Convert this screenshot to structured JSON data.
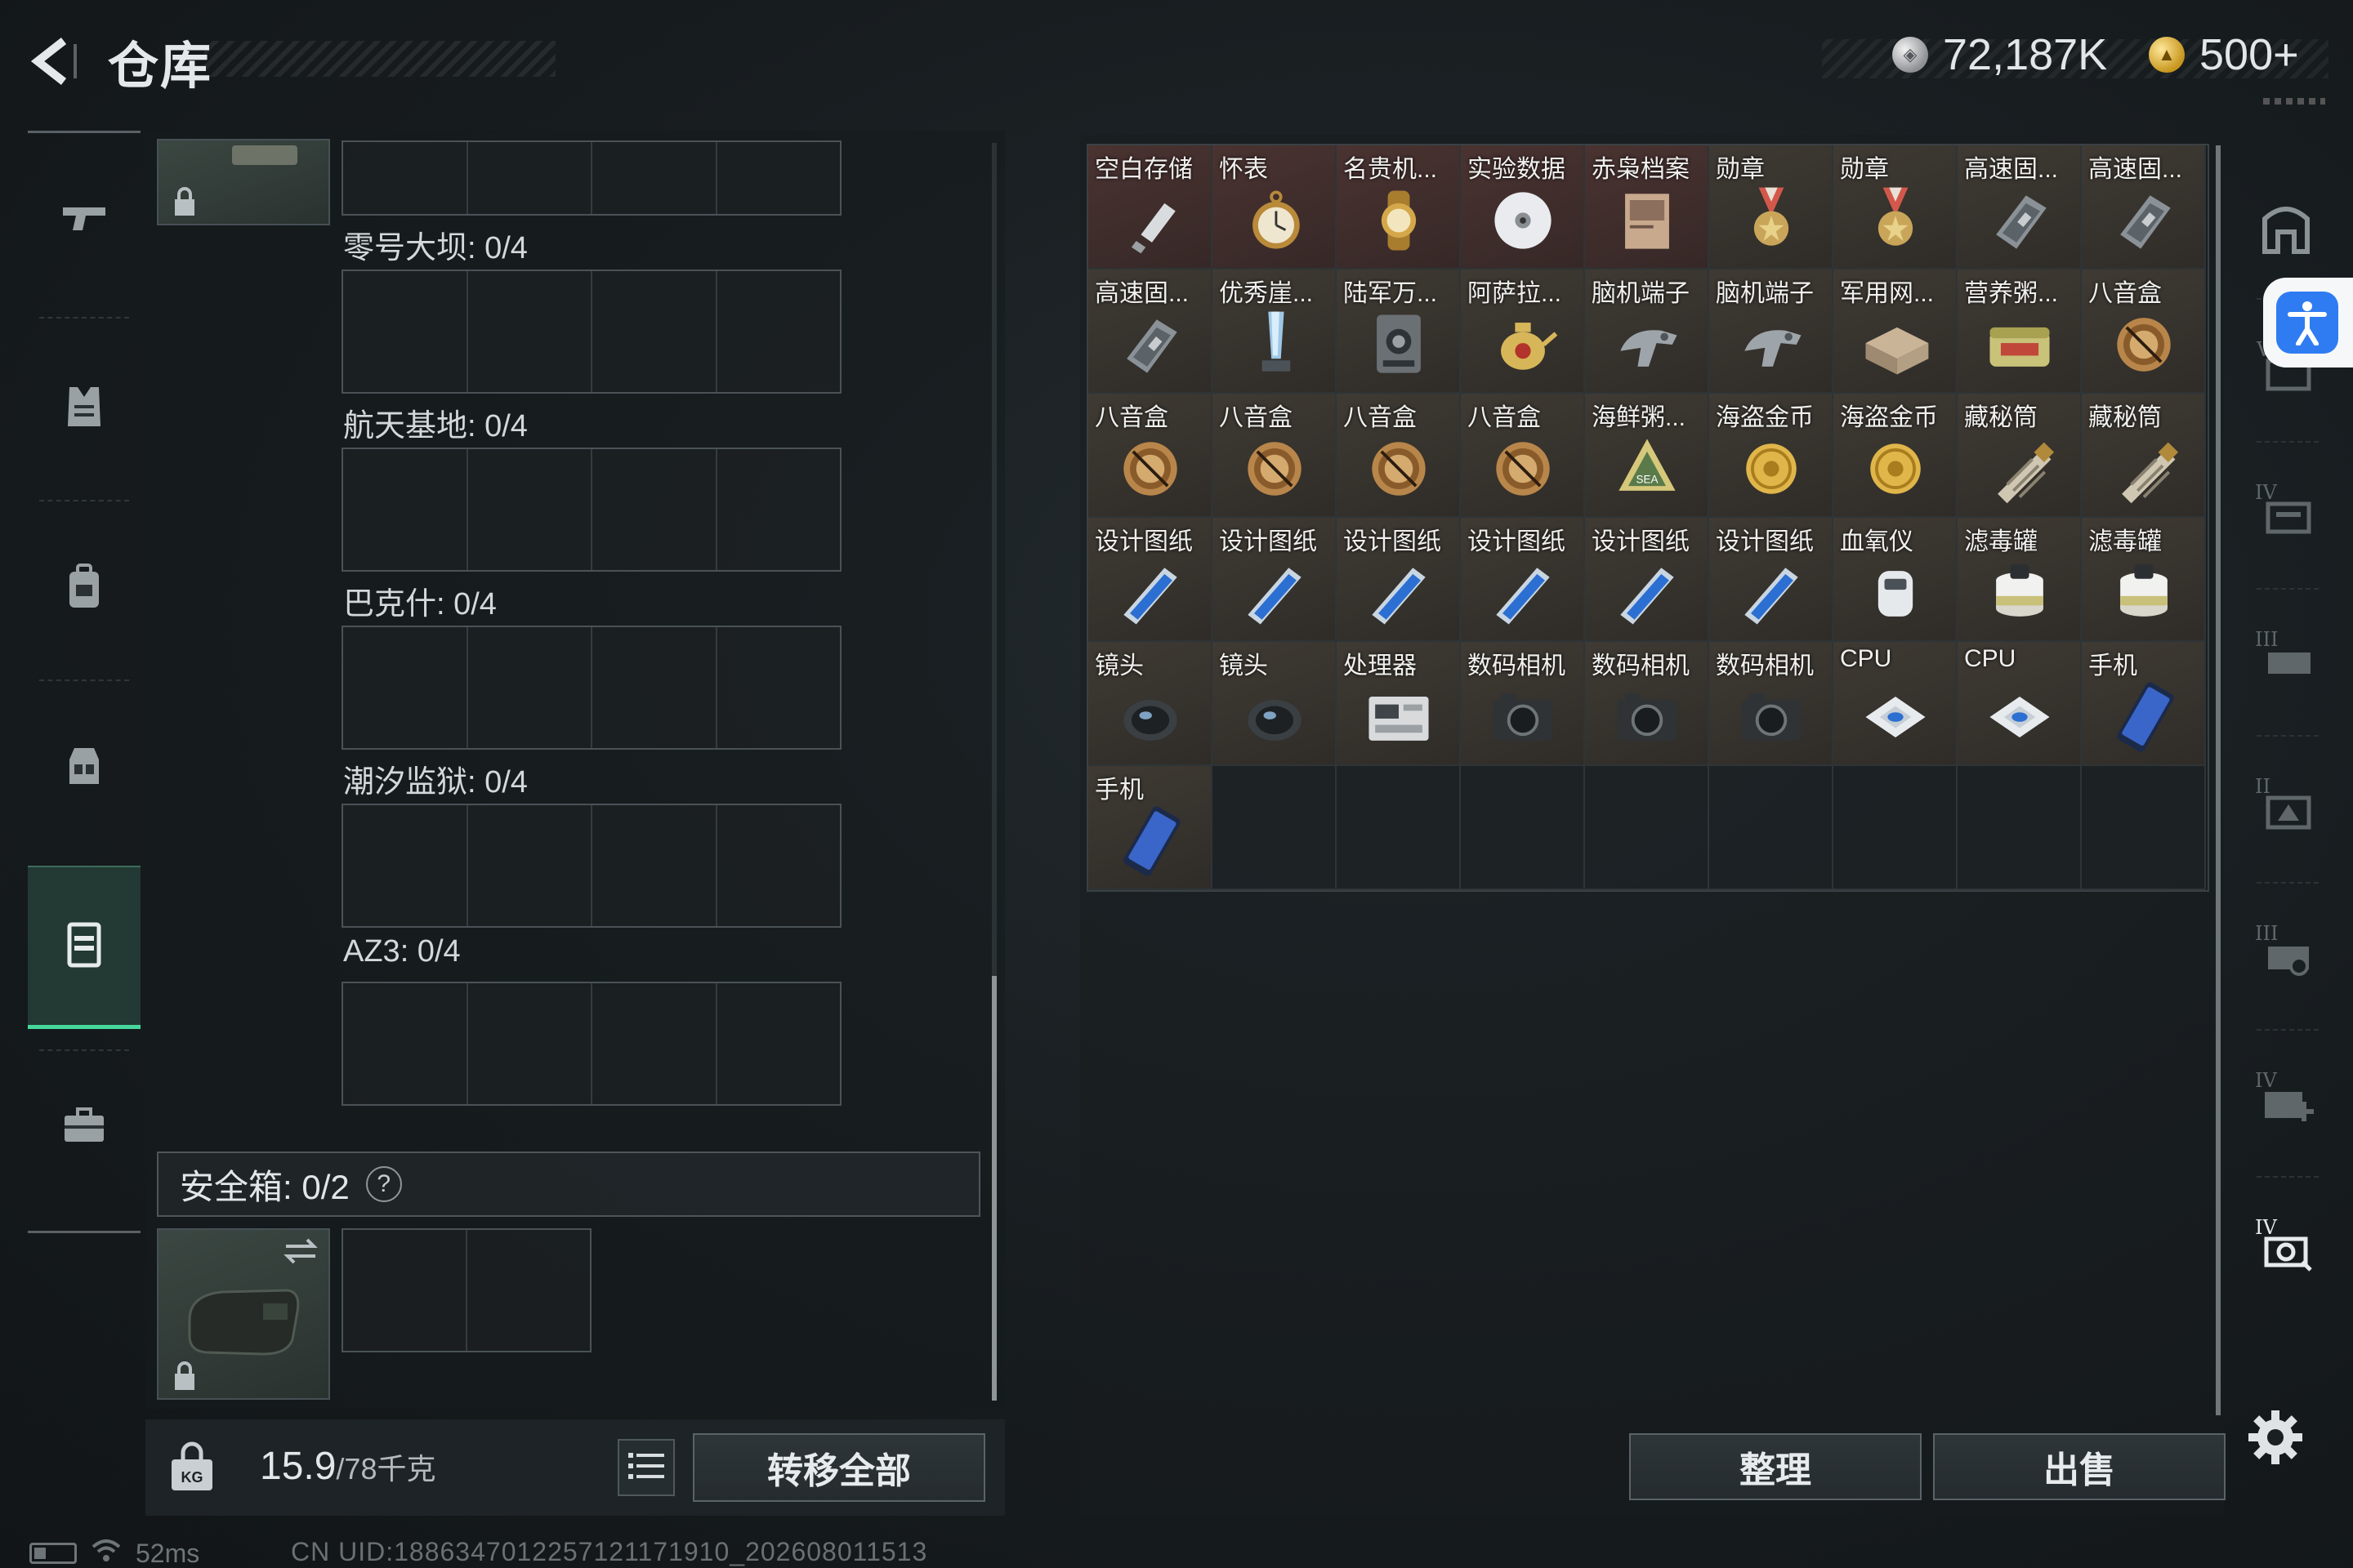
{
  "header": {
    "title": "仓库",
    "currency_silver": "72,187K",
    "currency_gold": "500+"
  },
  "left_nav": {
    "items": [
      {
        "icon": "pistol-icon"
      },
      {
        "icon": "armor-vest-icon"
      },
      {
        "icon": "backpack-icon"
      },
      {
        "icon": "chest-rig-icon"
      },
      {
        "icon": "container-icon",
        "active": true
      },
      {
        "icon": "case-icon"
      }
    ]
  },
  "slots": {
    "labels": [
      "零号大坝: 0/4",
      "航天基地: 0/4",
      "巴克什: 0/4",
      "潮汐监狱: 0/4",
      "AZ3: 0/4"
    ]
  },
  "safe_box": {
    "label": "安全箱:  0/2",
    "help": "?"
  },
  "footer_left": {
    "weight_value": "15.9",
    "weight_unit": "/78千克",
    "transfer_all": "转移全部"
  },
  "status": {
    "ping": "52ms",
    "uid": "CN UID:1886347012257121171910_202608011513"
  },
  "stash": {
    "items": [
      {
        "name": "空白存储",
        "icon": "usb-drive-icon",
        "rarity": "rare"
      },
      {
        "name": "怀表",
        "icon": "pocket-watch-icon",
        "rarity": "rare"
      },
      {
        "name": "名贵机...",
        "icon": "luxury-watch-icon",
        "rarity": "rare"
      },
      {
        "name": "实验数据",
        "icon": "disc-icon",
        "rarity": "rare"
      },
      {
        "name": "赤枭档案",
        "icon": "archive-icon",
        "rarity": "rare"
      },
      {
        "name": "勋章",
        "icon": "medal-icon",
        "rarity": "normal"
      },
      {
        "name": "勋章",
        "icon": "medal-icon",
        "rarity": "normal"
      },
      {
        "name": "高速固...",
        "icon": "ssd-icon",
        "rarity": "normal"
      },
      {
        "name": "高速固...",
        "icon": "ssd-icon",
        "rarity": "normal"
      },
      {
        "name": "高速固...",
        "icon": "ssd-icon",
        "rarity": "normal"
      },
      {
        "name": "优秀崖...",
        "icon": "crystal-trophy-icon",
        "rarity": "normal"
      },
      {
        "name": "陆军万...",
        "icon": "radio-device-icon",
        "rarity": "normal"
      },
      {
        "name": "阿萨拉...",
        "icon": "teapot-icon",
        "rarity": "normal"
      },
      {
        "name": "脑机端子",
        "icon": "neural-terminal-icon",
        "rarity": "normal"
      },
      {
        "name": "脑机端子",
        "icon": "neural-terminal-icon",
        "rarity": "normal"
      },
      {
        "name": "军用网...",
        "icon": "network-box-icon",
        "rarity": "normal"
      },
      {
        "name": "营养粥...",
        "icon": "food-can-icon",
        "rarity": "normal"
      },
      {
        "name": "八音盒",
        "icon": "music-box-icon",
        "rarity": "normal"
      },
      {
        "name": "八音盒",
        "icon": "music-box-icon",
        "rarity": "normal"
      },
      {
        "name": "八音盒",
        "icon": "music-box-icon",
        "rarity": "normal"
      },
      {
        "name": "八音盒",
        "icon": "music-box-icon",
        "rarity": "normal"
      },
      {
        "name": "八音盒",
        "icon": "music-box-icon",
        "rarity": "normal"
      },
      {
        "name": "海鲜粥...",
        "icon": "food-pack-icon",
        "rarity": "normal"
      },
      {
        "name": "海盗金币",
        "icon": "gold-coin-icon",
        "rarity": "normal"
      },
      {
        "name": "海盗金币",
        "icon": "gold-coin-icon",
        "rarity": "normal"
      },
      {
        "name": "藏秘筒",
        "icon": "cryptex-icon",
        "rarity": "normal"
      },
      {
        "name": "藏秘筒",
        "icon": "cryptex-icon",
        "rarity": "normal"
      },
      {
        "name": "设计图纸",
        "icon": "blueprint-icon",
        "rarity": "normal"
      },
      {
        "name": "设计图纸",
        "icon": "blueprint-icon",
        "rarity": "normal"
      },
      {
        "name": "设计图纸",
        "icon": "blueprint-icon",
        "rarity": "normal"
      },
      {
        "name": "设计图纸",
        "icon": "blueprint-icon",
        "rarity": "normal"
      },
      {
        "name": "设计图纸",
        "icon": "blueprint-icon",
        "rarity": "normal"
      },
      {
        "name": "设计图纸",
        "icon": "blueprint-icon",
        "rarity": "normal"
      },
      {
        "name": "血氧仪",
        "icon": "oximeter-icon",
        "rarity": "normal"
      },
      {
        "name": "滤毒罐",
        "icon": "filter-canister-icon",
        "rarity": "normal"
      },
      {
        "name": "滤毒罐",
        "icon": "filter-canister-icon",
        "rarity": "normal"
      },
      {
        "name": "镜头",
        "icon": "lens-icon",
        "rarity": "normal"
      },
      {
        "name": "镜头",
        "icon": "lens-icon",
        "rarity": "normal"
      },
      {
        "name": "处理器",
        "icon": "processor-box-icon",
        "rarity": "normal"
      },
      {
        "name": "数码相机",
        "icon": "camera-icon",
        "rarity": "normal"
      },
      {
        "name": "数码相机",
        "icon": "camera-icon",
        "rarity": "normal"
      },
      {
        "name": "数码相机",
        "icon": "camera-icon",
        "rarity": "normal"
      },
      {
        "name": "CPU",
        "icon": "cpu-icon",
        "rarity": "normal"
      },
      {
        "name": "CPU",
        "icon": "cpu-icon",
        "rarity": "normal"
      },
      {
        "name": "手机",
        "icon": "phone-icon",
        "rarity": "normal"
      },
      {
        "name": "手机",
        "icon": "phone-icon",
        "rarity": "normal"
      }
    ],
    "total_cells": 54
  },
  "footer_right": {
    "sort": "整理",
    "sell": "出售"
  },
  "right_nav": {
    "items": [
      "stash-home-icon",
      "stash-tab-v-icon",
      "stash-tab-iv-icon",
      "stash-tab-iii-icon",
      "stash-tab-ii-icon",
      "stash-tab-iii-b-icon",
      "stash-tab-iv-plus-icon",
      "stash-tab-iv-active-icon"
    ]
  },
  "colors": {
    "accent_green": "#47d79c",
    "accessibility_blue": "#2f7cf2",
    "rare_cell": "#4a3331"
  }
}
